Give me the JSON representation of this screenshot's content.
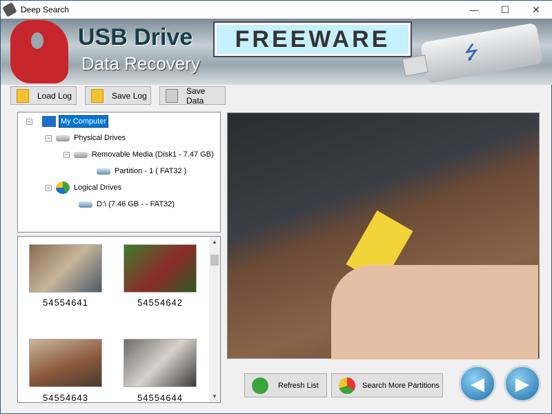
{
  "window": {
    "title": "Deep Search",
    "minimize": "—",
    "maximize": "☐",
    "close": "✕"
  },
  "banner": {
    "title": "USB Drive",
    "subtitle": "Data Recovery",
    "badge": "FREEWARE",
    "usb_symbol": "⭍"
  },
  "toolbar": {
    "load_log": "Load Log",
    "save_log": "Save Log",
    "save_data": "Save Data"
  },
  "tree": {
    "root": "My Computer",
    "physical": "Physical Drives",
    "removable": "Removable Media (Disk1 - 7.47 GB)",
    "partition": "Partition - 1 ( FAT32 )",
    "logical": "Logical Drives",
    "drive_d": "D:\\ (7.46 GB -  - FAT32)",
    "collapse": "−"
  },
  "thumbnails": [
    {
      "name": "54554641"
    },
    {
      "name": "54554642"
    },
    {
      "name": "54554643"
    },
    {
      "name": "54554644"
    }
  ],
  "scroll": {
    "up": "▲",
    "down": "▼"
  },
  "actions": {
    "refresh": "Refresh List",
    "search_more": "Search More Partitions",
    "prev": "◀",
    "next": "▶"
  }
}
